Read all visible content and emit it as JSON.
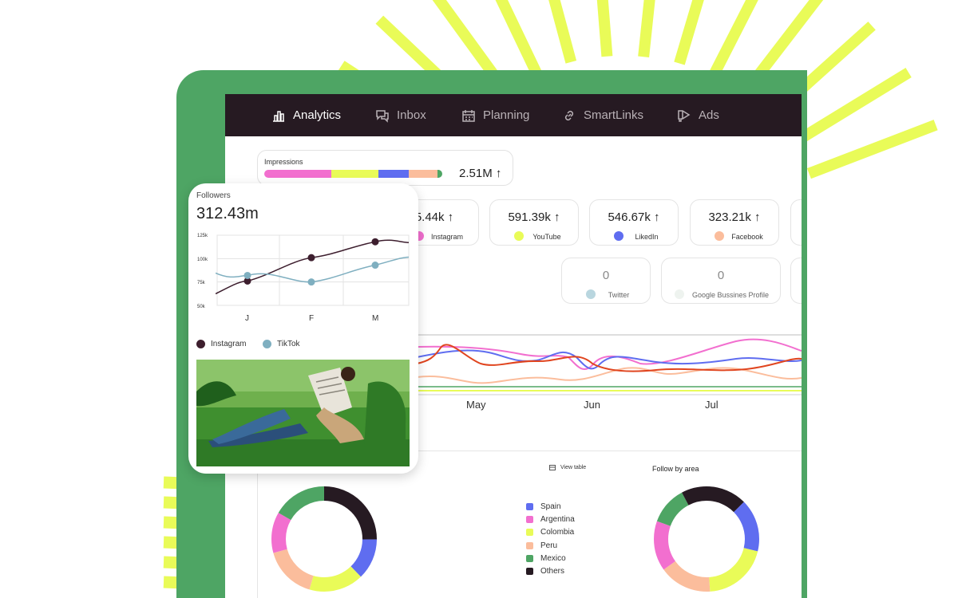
{
  "nav": {
    "items": [
      {
        "label": "Analytics",
        "icon": "bar-chart-icon",
        "active": true
      },
      {
        "label": "Inbox",
        "icon": "chat-icon",
        "active": false
      },
      {
        "label": "Planning",
        "icon": "calendar-icon",
        "active": false
      },
      {
        "label": "SmartLinks",
        "icon": "link-icon",
        "active": false
      },
      {
        "label": "Ads",
        "icon": "megaphone-icon",
        "active": false
      }
    ]
  },
  "impressions": {
    "label": "Impressions",
    "value": "2.51M ↑",
    "segments": [
      "#f26fcf",
      "#e9fb58",
      "#5f6df0",
      "#fbbd9c",
      "#4ea564"
    ]
  },
  "stats": [
    {
      "value": "5.44k ↑",
      "label": "Instagram",
      "color": "#f26fcf"
    },
    {
      "value": "591.39k ↑",
      "label": "YouTube",
      "color": "#e9fb58"
    },
    {
      "value": "546.67k ↑",
      "label": "LikedIn",
      "color": "#5f6df0"
    },
    {
      "value": "323.21k ↑",
      "label": "Facebook",
      "color": "#fbbd9c"
    }
  ],
  "stats_secondary": [
    {
      "value": "0",
      "label": "Twitter",
      "color": "#b9d6df"
    },
    {
      "value": "0",
      "label": "Google Bussines Profile",
      "color": "#eef3ef"
    }
  ],
  "main_chart": {
    "months": [
      "May",
      "Jun",
      "Jul"
    ]
  },
  "table_link": {
    "icon": "table-icon",
    "label": "View table"
  },
  "follow_by_area": {
    "title": "Follow by area",
    "legend": [
      {
        "label": "Spain",
        "color": "#5f6df0"
      },
      {
        "label": "Argentina",
        "color": "#f26fcf"
      },
      {
        "label": "Colombia",
        "color": "#e9fb58"
      },
      {
        "label": "Peru",
        "color": "#fbbd9c"
      },
      {
        "label": "Mexico",
        "color": "#4ea564"
      },
      {
        "label": "Others",
        "color": "#261a22"
      }
    ]
  },
  "followers": {
    "title": "Followers",
    "value": "312.43m",
    "chart_data": {
      "type": "line",
      "x": [
        "J",
        "F",
        "M"
      ],
      "ylim": [
        50,
        125
      ],
      "yticks": [
        "125k",
        "100k",
        "75k",
        "50k"
      ],
      "series": [
        {
          "name": "Instagram",
          "color": "#3d1e2e",
          "values": [
            76,
            101,
            118
          ]
        },
        {
          "name": "TikTok",
          "color": "#7fafc0",
          "values": [
            82,
            75,
            93
          ]
        }
      ]
    }
  }
}
